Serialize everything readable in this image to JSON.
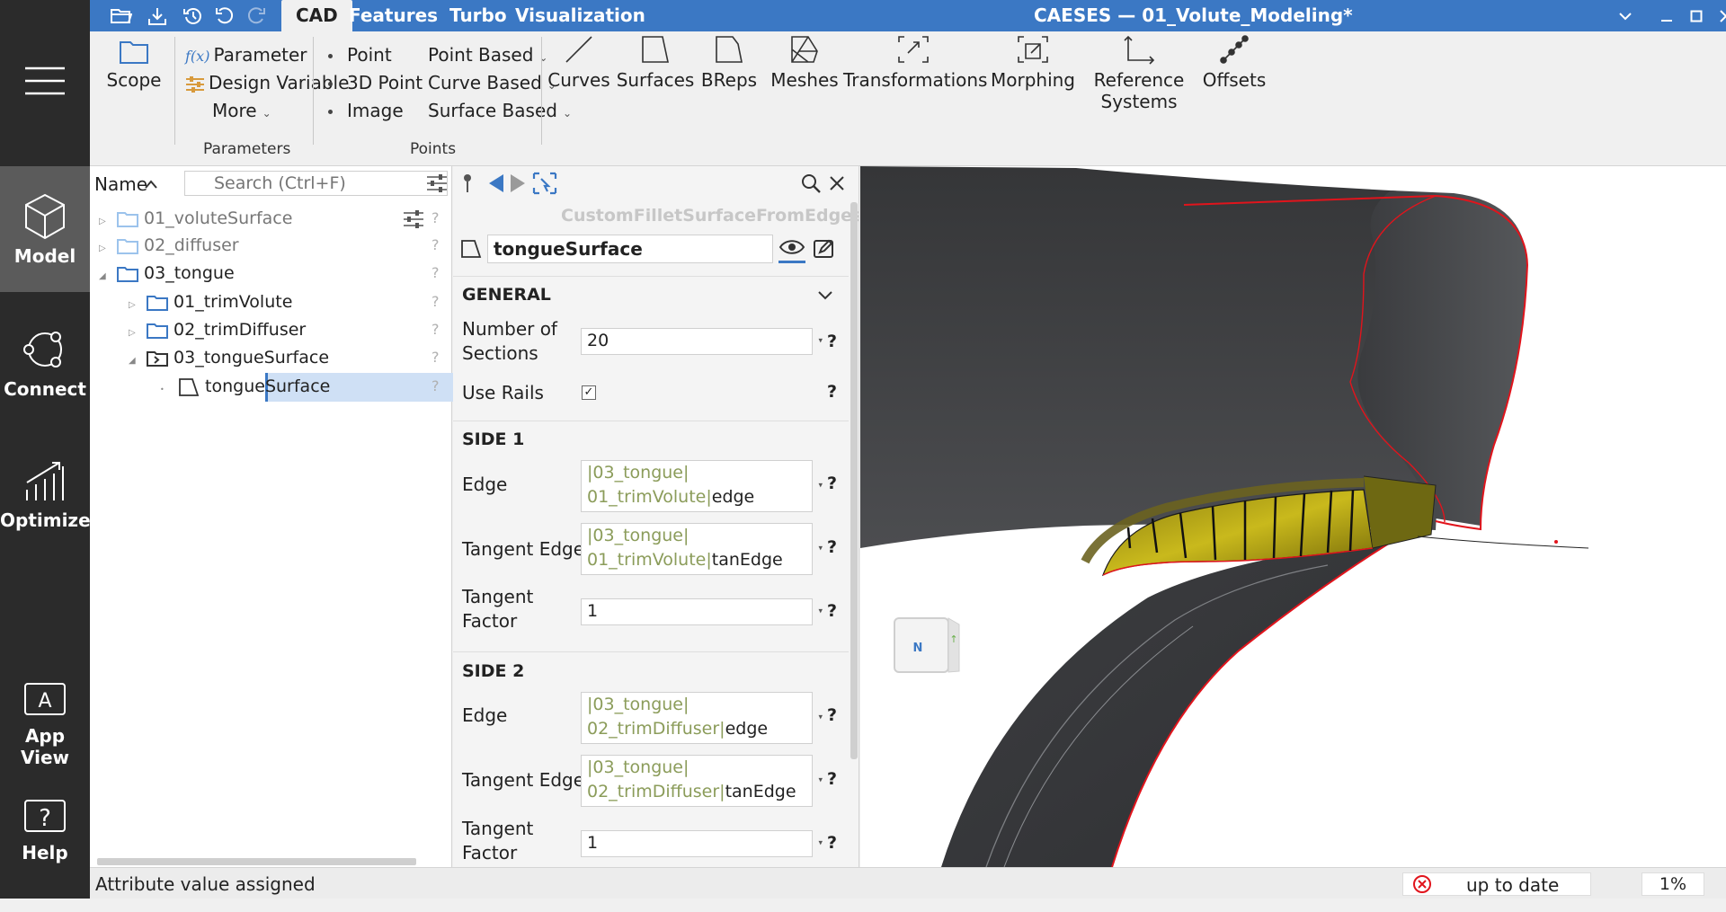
{
  "app": {
    "title": "CAESES — 01_Volute_Modeling*"
  },
  "menu_tabs": [
    {
      "label": "CAD",
      "active": true
    },
    {
      "label": "Features"
    },
    {
      "label": "Turbo"
    },
    {
      "label": "Visualization"
    }
  ],
  "left_nav": {
    "items": [
      {
        "label": "Model",
        "icon": "cube-icon",
        "active": true
      },
      {
        "label": "Connect",
        "icon": "connect-icon"
      },
      {
        "label": "Optimize",
        "icon": "optimize-icon"
      },
      {
        "label": "App View",
        "icon": "app-view-icon"
      },
      {
        "label": "Help",
        "icon": "help-icon"
      }
    ]
  },
  "ribbon": {
    "scope": "Scope",
    "parameters": {
      "parameter": "Parameter",
      "fx": "f(x)",
      "design_variable": "Design Variable",
      "more": "More",
      "group": "Parameters"
    },
    "points": {
      "point": "Point",
      "point3d": "3D Point",
      "image": "Image",
      "point_based": "Point Based",
      "curve_based": "Curve Based",
      "surface_based": "Surface Based",
      "group": "Points"
    },
    "curves": "Curves",
    "surfaces": "Surfaces",
    "breps": "BReps",
    "meshes": "Meshes",
    "transformations": "Transformations",
    "morphing": "Morphing",
    "reference_systems_1": "Reference",
    "reference_systems_2": "Systems",
    "offsets": "Offsets"
  },
  "tree": {
    "header": "Name",
    "search_placeholder": "Search (Ctrl+F)",
    "items": [
      {
        "label": "01_voluteSurface",
        "muted": true
      },
      {
        "label": "02_diffuser",
        "muted": true
      },
      {
        "label": "03_tongue"
      },
      {
        "label": "01_trimVolute"
      },
      {
        "label": "02_trimDiffuser"
      },
      {
        "label": "03_tongueSurface"
      },
      {
        "label": "tongueSurface",
        "selected": true
      }
    ]
  },
  "properties": {
    "type_name": "CustomFilletSurfaceFromEdges",
    "object_name": "tongueSurface",
    "general": {
      "title": "GENERAL",
      "num_sections_label_1": "Number of",
      "num_sections_label_2": "Sections",
      "num_sections_value": "20",
      "use_rails_label": "Use Rails",
      "use_rails_checked": true
    },
    "side1": {
      "title": "SIDE 1",
      "edge_label": "Edge",
      "edge_path": "|03_tongue|",
      "edge_scope": "01_trimVolute",
      "edge_sep": "|",
      "edge_attr": "edge",
      "tan_label": "Tangent Edge",
      "tan_path": "|03_tongue|",
      "tan_scope": "01_trimVolute",
      "tan_sep": "|",
      "tan_attr": "tanEdge",
      "factor_label_1": "Tangent",
      "factor_label_2": "Factor",
      "factor_value": "1"
    },
    "side2": {
      "title": "SIDE 2",
      "edge_label": "Edge",
      "edge_path": "|03_tongue|",
      "edge_scope": "02_trimDiffuser",
      "edge_sep": "|",
      "edge_attr": "edge",
      "tan_label": "Tangent Edge",
      "tan_path": "|03_tongue|",
      "tan_scope": "02_trimDiffuser",
      "tan_sep": "|",
      "tan_attr": "tanEdge",
      "factor_label_1": "Tangent",
      "factor_label_2": "Factor",
      "factor_value": "1"
    },
    "help": "?"
  },
  "view_cube": {
    "face_label": "N"
  },
  "status": {
    "message": "Attribute value assigned",
    "state": "up to date",
    "percent": "1%"
  }
}
